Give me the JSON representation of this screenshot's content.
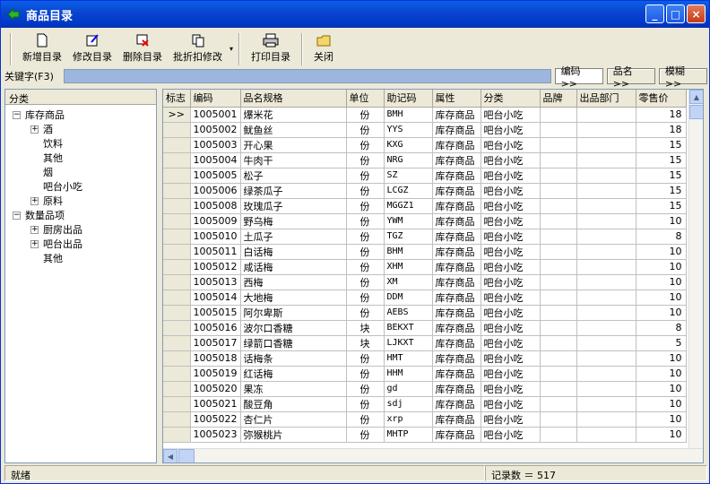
{
  "window": {
    "title": "商品目录",
    "minimize": "_",
    "maximize": "□",
    "close": "×"
  },
  "toolbar": {
    "new": "新增目录",
    "edit": "修改目录",
    "delete": "删除目录",
    "discount": "批折扣修改",
    "dropdown": "▾",
    "print": "打印目录",
    "close": "关闭"
  },
  "search": {
    "label": "关键字(F3)",
    "value": "",
    "btn_code": "编码>>",
    "btn_name": "品名>>",
    "btn_fuzzy": "模糊>>"
  },
  "tree": {
    "header": "分类",
    "nodes": [
      {
        "label": "库存商品",
        "expander": "−"
      },
      {
        "label": "酒",
        "expander": "+"
      },
      {
        "label": "饮料",
        "expander": ""
      },
      {
        "label": "其他",
        "expander": ""
      },
      {
        "label": "烟",
        "expander": ""
      },
      {
        "label": "吧台小吃",
        "expander": ""
      },
      {
        "label": "原料",
        "expander": "+"
      },
      {
        "label": "数量品项",
        "expander": "−"
      },
      {
        "label": "厨房出品",
        "expander": "+"
      },
      {
        "label": "吧台出品",
        "expander": "+"
      },
      {
        "label": "其他",
        "expander": ""
      }
    ]
  },
  "table": {
    "columns": [
      "标志",
      "编码",
      "品名规格",
      "单位",
      "助记码",
      "属性",
      "分类",
      "品牌",
      "出品部门",
      "零售价"
    ],
    "rows": [
      [
        ">>",
        "1005001",
        "爆米花",
        "份",
        "BMH",
        "库存商品",
        "吧台小吃",
        "",
        "",
        "18"
      ],
      [
        "",
        "1005002",
        "鱿鱼丝",
        "份",
        "YYS",
        "库存商品",
        "吧台小吃",
        "",
        "",
        "18"
      ],
      [
        "",
        "1005003",
        "开心果",
        "份",
        "KXG",
        "库存商品",
        "吧台小吃",
        "",
        "",
        "15"
      ],
      [
        "",
        "1005004",
        "牛肉干",
        "份",
        "NRG",
        "库存商品",
        "吧台小吃",
        "",
        "",
        "15"
      ],
      [
        "",
        "1005005",
        "松子",
        "份",
        "SZ",
        "库存商品",
        "吧台小吃",
        "",
        "",
        "15"
      ],
      [
        "",
        "1005006",
        "绿茶瓜子",
        "份",
        "LCGZ",
        "库存商品",
        "吧台小吃",
        "",
        "",
        "15"
      ],
      [
        "",
        "1005008",
        "玫瑰瓜子",
        "份",
        "MGGZ1",
        "库存商品",
        "吧台小吃",
        "",
        "",
        "15"
      ],
      [
        "",
        "1005009",
        "野乌梅",
        "份",
        "YWM",
        "库存商品",
        "吧台小吃",
        "",
        "",
        "10"
      ],
      [
        "",
        "1005010",
        "土瓜子",
        "份",
        "TGZ",
        "库存商品",
        "吧台小吃",
        "",
        "",
        "8"
      ],
      [
        "",
        "1005011",
        "白话梅",
        "份",
        "BHM",
        "库存商品",
        "吧台小吃",
        "",
        "",
        "10"
      ],
      [
        "",
        "1005012",
        "咸话梅",
        "份",
        "XHM",
        "库存商品",
        "吧台小吃",
        "",
        "",
        "10"
      ],
      [
        "",
        "1005013",
        "西梅",
        "份",
        "XM",
        "库存商品",
        "吧台小吃",
        "",
        "",
        "10"
      ],
      [
        "",
        "1005014",
        "大地梅",
        "份",
        "DDM",
        "库存商品",
        "吧台小吃",
        "",
        "",
        "10"
      ],
      [
        "",
        "1005015",
        "阿尔卑斯",
        "份",
        "AEBS",
        "库存商品",
        "吧台小吃",
        "",
        "",
        "10"
      ],
      [
        "",
        "1005016",
        "波尔口香糖",
        "块",
        "BEKXT",
        "库存商品",
        "吧台小吃",
        "",
        "",
        "8"
      ],
      [
        "",
        "1005017",
        "绿箭口香糖",
        "块",
        "LJKXT",
        "库存商品",
        "吧台小吃",
        "",
        "",
        "5"
      ],
      [
        "",
        "1005018",
        "话梅条",
        "份",
        "HMT",
        "库存商品",
        "吧台小吃",
        "",
        "",
        "10"
      ],
      [
        "",
        "1005019",
        "红话梅",
        "份",
        "HHM",
        "库存商品",
        "吧台小吃",
        "",
        "",
        "10"
      ],
      [
        "",
        "1005020",
        "果冻",
        "份",
        "gd",
        "库存商品",
        "吧台小吃",
        "",
        "",
        "10"
      ],
      [
        "",
        "1005021",
        "酸豆角",
        "份",
        "sdj",
        "库存商品",
        "吧台小吃",
        "",
        "",
        "10"
      ],
      [
        "",
        "1005022",
        "杏仁片",
        "份",
        "xrp",
        "库存商品",
        "吧台小吃",
        "",
        "",
        "10"
      ],
      [
        "",
        "1005023",
        "弥猴桃片",
        "份",
        "MHTP",
        "库存商品",
        "吧台小吃",
        "",
        "",
        "10"
      ]
    ]
  },
  "status": {
    "left": "就绪",
    "record_count": "记录数 ＝ 517"
  }
}
